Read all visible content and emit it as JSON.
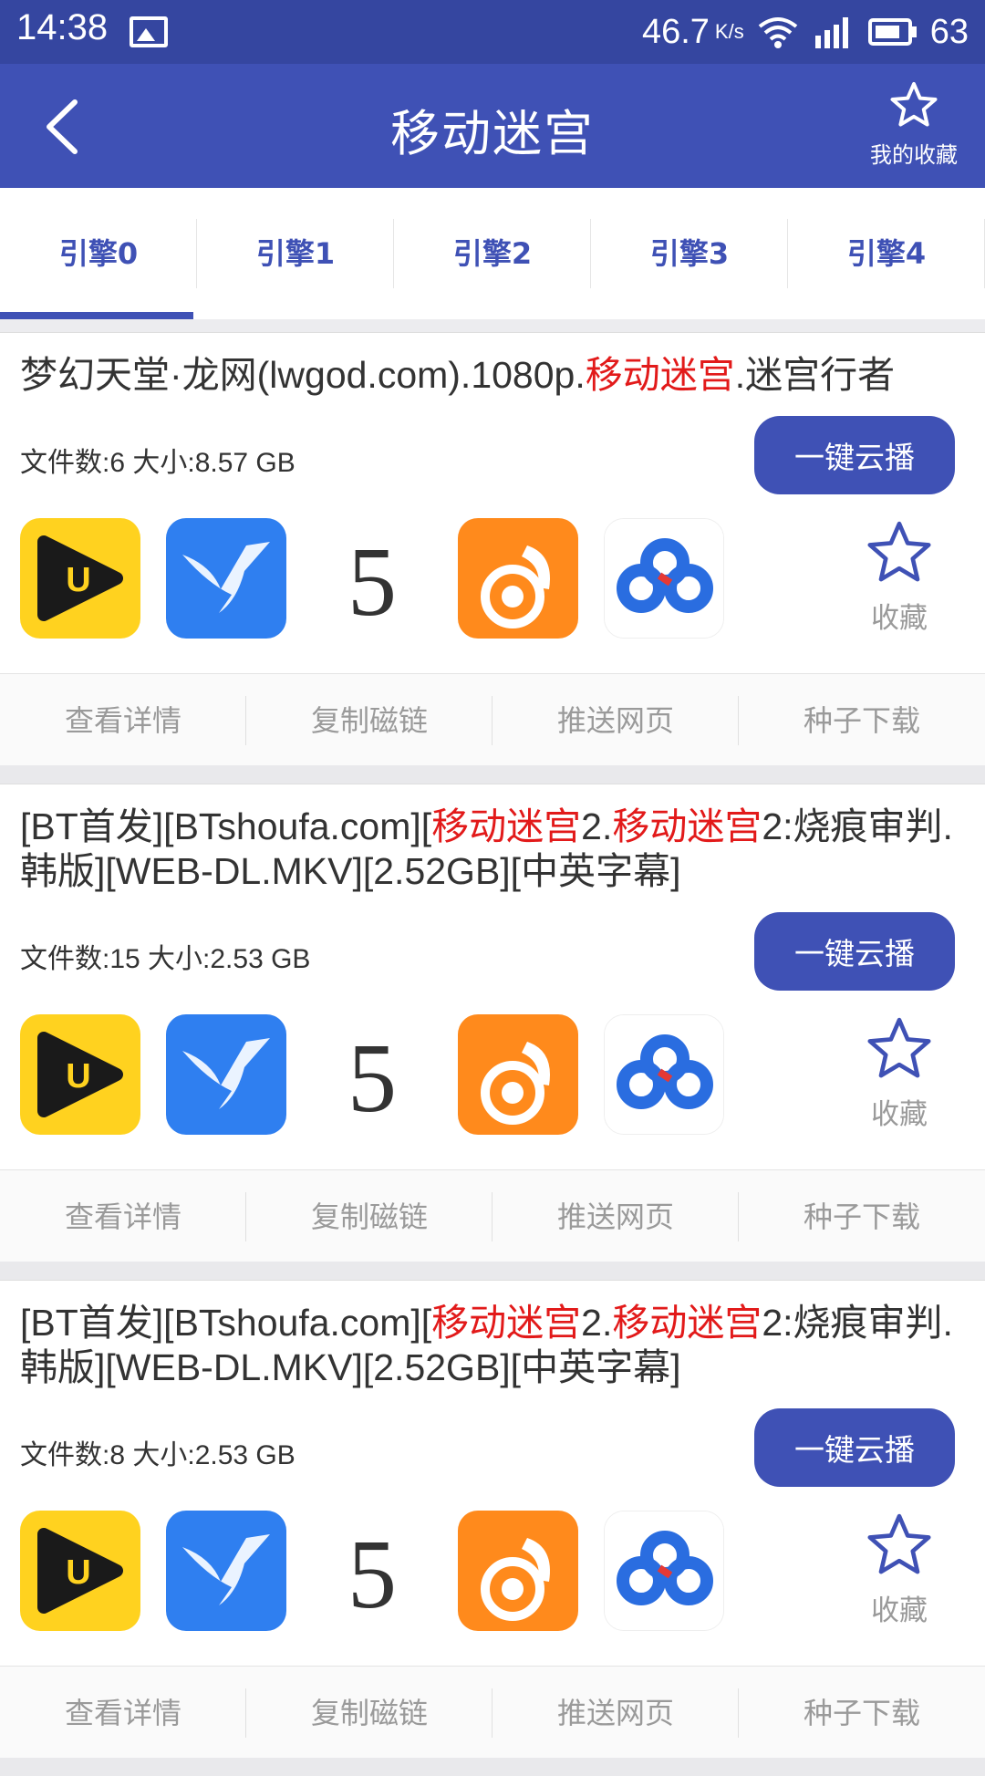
{
  "status_bar": {
    "time": "14:38",
    "speed": "46.7",
    "speed_unit": "K/s",
    "battery": "63"
  },
  "app_bar": {
    "title": "移动迷宫",
    "favorites_label": "我的收藏"
  },
  "tabs": [
    {
      "label": "引擎0",
      "active": true
    },
    {
      "label": "引擎1",
      "active": false
    },
    {
      "label": "引擎2",
      "active": false
    },
    {
      "label": "引擎3",
      "active": false
    },
    {
      "label": "引擎4",
      "active": false
    }
  ],
  "results": [
    {
      "title_parts": [
        {
          "text": "梦幻天堂·龙网(lwgod.com).1080p.",
          "hl": false
        },
        {
          "text": "移动迷宫",
          "hl": true
        },
        {
          "text": ".迷宫行者",
          "hl": false
        }
      ],
      "meta": "文件数:6 大小:8.57 GB",
      "play_label": "一键云播",
      "collect_label": "收藏",
      "actions": [
        "查看详情",
        "复制磁链",
        "推送网页",
        "种子下载"
      ]
    },
    {
      "title_parts": [
        {
          "text": "[BT首发][BTshoufa.com][",
          "hl": false
        },
        {
          "text": "移动迷宫",
          "hl": true
        },
        {
          "text": "2.",
          "hl": false
        },
        {
          "text": "移动迷宫",
          "hl": true
        },
        {
          "text": "2:烧痕审判.韩版][WEB-DL.MKV][2.52GB][中英字幕]",
          "hl": false
        }
      ],
      "meta": "文件数:15 大小:2.53 GB",
      "play_label": "一键云播",
      "collect_label": "收藏",
      "actions": [
        "查看详情",
        "复制磁链",
        "推送网页",
        "种子下载"
      ]
    },
    {
      "title_parts": [
        {
          "text": "[BT首发][BTshoufa.com][",
          "hl": false
        },
        {
          "text": "移动迷宫",
          "hl": true
        },
        {
          "text": "2.",
          "hl": false
        },
        {
          "text": "移动迷宫",
          "hl": true
        },
        {
          "text": "2:烧痕审判.韩版][WEB-DL.MKV][2.52GB][中英字幕]",
          "hl": false
        }
      ],
      "meta": "文件数:8 大小:2.53 GB",
      "play_label": "一键云播",
      "collect_label": "收藏",
      "actions": [
        "查看详情",
        "复制磁链",
        "推送网页",
        "种子下载"
      ]
    }
  ],
  "app_icons": [
    {
      "name": "u-player",
      "bg": "#ffd21f",
      "glyph": "U"
    },
    {
      "name": "xunlei",
      "bg": "#2f7ff0"
    },
    {
      "name": "five",
      "bg": "#ffffff",
      "glyph": "5"
    },
    {
      "name": "uc-browser",
      "bg": "#ff8a1c"
    },
    {
      "name": "baidu-cloud",
      "bg": "#ffffff"
    }
  ],
  "colors": {
    "primary": "#3f51b5",
    "status_bar": "#3546a0",
    "highlight": "#e21a1a"
  }
}
